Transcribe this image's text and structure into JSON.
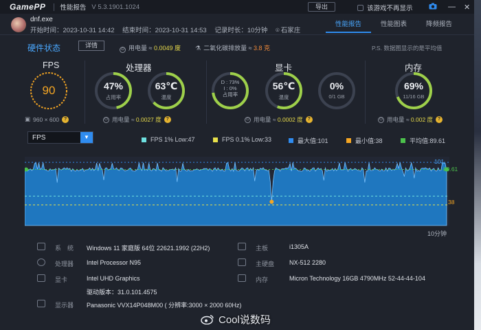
{
  "titlebar": {
    "app_name": "GamePP",
    "title": "性能报告",
    "version": "V 5.3.1901.1024",
    "export_label": "导出",
    "dont_show_label": "该游戏不再显示"
  },
  "session": {
    "process": "dnf.exe",
    "start": "开始时间：2023-10-31 14:42",
    "end": "结束时间：2023-10-31 14:53",
    "duration": "记录时长：10分钟",
    "location": "石家庄"
  },
  "tabs": [
    {
      "label": "性能报告",
      "active": true
    },
    {
      "label": "性能图表",
      "active": false
    },
    {
      "label": "降频报告",
      "active": false
    }
  ],
  "hardware": {
    "title": "硬件状态",
    "detail_label": "详情",
    "power_prefix": "用电量 ≈",
    "power_value": "0.0049 度",
    "carbon_prefix": "二氧化碳排放量 ≈",
    "carbon_value": "3.8 克",
    "note": "P.S. 数据图显示的是平均值"
  },
  "fps": {
    "title": "FPS",
    "value": "90",
    "resolution": "960 × 600"
  },
  "cpu": {
    "title": "处理器",
    "usage_value": "47%",
    "usage_label": "占用率",
    "usage_level": 0.47,
    "temp_value": "63℃",
    "temp_label": "温度",
    "temp_level": 0.63,
    "power_prefix": "用电量 ≈",
    "power_value": "0.0027 度"
  },
  "gpu": {
    "title": "显卡",
    "d_line": "D : 73%",
    "i_line": "I : 0%",
    "usage_label": "占用率",
    "usage_level": 0.73,
    "temp_value": "56℃",
    "temp_label": "温度",
    "temp_level": 0.56,
    "vram_value": "0%",
    "vram_label": "0/1 GB",
    "vram_level": 0,
    "power_prefix": "用电量 ≈",
    "power_value": "0.0002 度"
  },
  "memory": {
    "title": "内存",
    "usage_value": "69%",
    "usage_label": "11/16 GB",
    "usage_level": 0.69,
    "power_prefix": "用电量 ≈",
    "power_value": "0.002 度"
  },
  "chart_header": {
    "selected": "FPS",
    "legend": [
      {
        "label": "FPS 1% Low:47",
        "color": "#6ee0e0"
      },
      {
        "label": "FPS 0.1% Low:33",
        "color": "#e8e04a"
      },
      {
        "label": "最大值:101",
        "color": "#2f8cf0"
      },
      {
        "label": "最小值:38",
        "color": "#f5a623"
      },
      {
        "label": "平均值:89.61",
        "color": "#4cc24c"
      }
    ]
  },
  "chart_data": {
    "type": "area",
    "ylim": [
      0,
      110
    ],
    "max": 101,
    "min": 38,
    "avg": 89.61,
    "low1": 47,
    "low01": 33,
    "tick_max": "101",
    "tick_avg": "89.61",
    "tick_min": "38",
    "xlabel_end": "10分钟",
    "fill_color": "#1e86d8",
    "line_color": "#7cc4ff"
  },
  "system": [
    {
      "key": "系　统",
      "value": "Windows 11 家庭版 64位 22621.1992 (22H2)"
    },
    {
      "key": "处理器",
      "value": "Intel Processor N95"
    },
    {
      "key": "显卡",
      "value": "Intel UHD Graphics"
    },
    {
      "key": "",
      "value": "驱动版本：31.0.101.4575"
    },
    {
      "key": "显示器",
      "value": "Panasonic VVX14P048M00 ( 分辨率:3000 × 2000 60Hz)"
    }
  ],
  "system_right": [
    {
      "key": "主板",
      "value": "i1305A"
    },
    {
      "key": "主硬盘",
      "value": "NX-512 2280"
    },
    {
      "key": "内存",
      "value": "Micron Technology 16GB 4790MHz 52-44-44-104"
    }
  ],
  "watermark": "Cool说数码"
}
